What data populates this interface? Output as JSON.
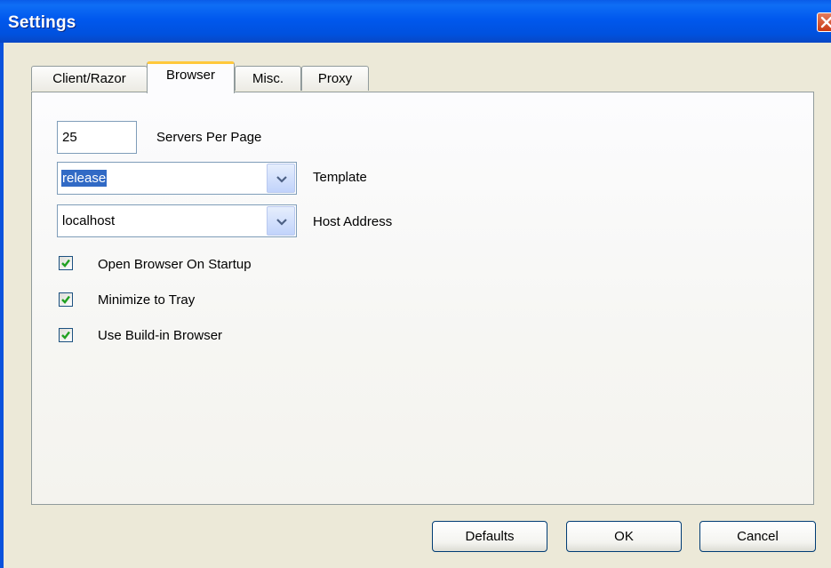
{
  "window": {
    "title": "Settings"
  },
  "tabs": [
    {
      "label": "Client/Razor",
      "active": false
    },
    {
      "label": "Browser",
      "active": true
    },
    {
      "label": "Misc.",
      "active": false
    },
    {
      "label": "Proxy",
      "active": false
    }
  ],
  "browser": {
    "servers_per_page": {
      "value": "25",
      "label": "Servers Per Page"
    },
    "template": {
      "value": "release",
      "label": "Template"
    },
    "host_address": {
      "value": "localhost",
      "label": "Host Address"
    },
    "options": [
      {
        "label": "Open Browser On Startup",
        "checked": true
      },
      {
        "label": "Minimize to Tray",
        "checked": true
      },
      {
        "label": "Use Build-in Browser",
        "checked": true
      }
    ]
  },
  "buttons": {
    "defaults": "Defaults",
    "ok": "OK",
    "cancel": "Cancel"
  },
  "icons": {
    "close": "close-icon",
    "dropdown": "chevron-down-icon",
    "check": "checkmark-icon"
  },
  "colors": {
    "titlebar": "#0058ee",
    "selection": "#316ac5",
    "active_tab_accent": "#ffc83c",
    "checkmark": "#21a121"
  }
}
